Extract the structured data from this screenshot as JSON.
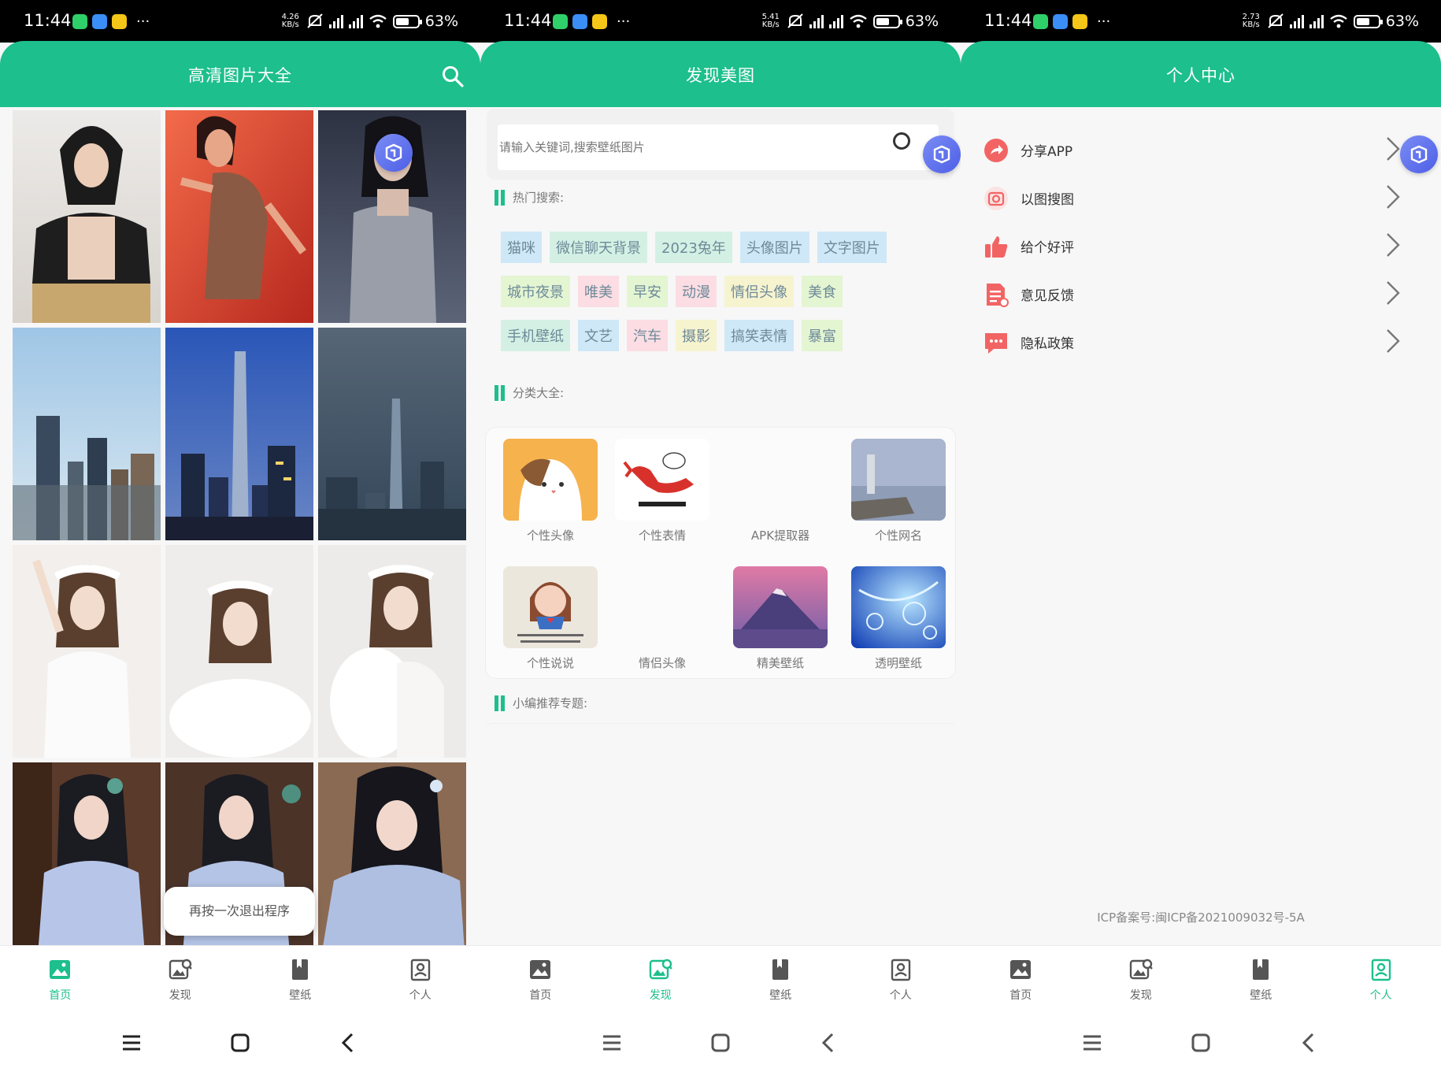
{
  "status_bars": [
    {
      "time": "11:44",
      "speed_value": "4.26",
      "speed_unit": "KB/s",
      "battery": "63%",
      "battery_level": 0.63
    },
    {
      "time": "11:44",
      "speed_value": "5.41",
      "speed_unit": "KB/s",
      "battery": "63%",
      "battery_level": 0.63
    },
    {
      "time": "11:44",
      "speed_value": "2.73",
      "speed_unit": "KB/s",
      "battery": "63%",
      "battery_level": 0.63
    }
  ],
  "status_dots": "···",
  "home": {
    "title": "高清图片大全",
    "toast": "再按一次退出程序",
    "images": [
      "portrait-black-jacket",
      "portrait-red-dress",
      "portrait-silver-dress",
      "city-skyline-day",
      "city-tower-dusk",
      "city-skyline-night",
      "girl-white-1",
      "girl-white-2",
      "girl-white-3",
      "hanfu-1",
      "hanfu-2",
      "hanfu-3"
    ]
  },
  "discover": {
    "title": "发现美图",
    "search_placeholder": "请输入关键词,搜索壁纸图片",
    "hot_label": "热门搜索:",
    "tags": [
      [
        {
          "text": "猫咪",
          "bg": "#cfe8f7"
        },
        {
          "text": "微信聊天背景",
          "bg": "#d4f0e4"
        },
        {
          "text": "2023兔年",
          "bg": "#d4f0e4"
        },
        {
          "text": "头像图片",
          "bg": "#cfe8f7"
        },
        {
          "text": "文字图片",
          "bg": "#cfe8f7"
        }
      ],
      [
        {
          "text": "城市夜景",
          "bg": "#e4f5d2"
        },
        {
          "text": "唯美",
          "bg": "#fbdde3"
        },
        {
          "text": "早安",
          "bg": "#e4f5d2"
        },
        {
          "text": "动漫",
          "bg": "#fbdde3"
        },
        {
          "text": "情侣头像",
          "bg": "#f6f3cf"
        },
        {
          "text": "美食",
          "bg": "#e4f5d2"
        }
      ],
      [
        {
          "text": "手机壁纸",
          "bg": "#d4f0e4"
        },
        {
          "text": "文艺",
          "bg": "#cfe8f7"
        },
        {
          "text": "汽车",
          "bg": "#fbdde3"
        },
        {
          "text": "摄影",
          "bg": "#f6f3cf"
        },
        {
          "text": "搞笑表情",
          "bg": "#cfe8f7"
        },
        {
          "text": "暴富",
          "bg": "#e4f5d2"
        }
      ]
    ],
    "category_label": "分类大全:",
    "categories": [
      "个性头像",
      "个性表情",
      "APK提取器",
      "个性网名",
      "个性说说",
      "情侣头像",
      "精美壁纸",
      "透明壁纸"
    ],
    "recommend_label": "小编推荐专题:"
  },
  "profile": {
    "title": "个人中心",
    "menu": [
      {
        "label": "分享APP",
        "icon": "share-icon",
        "color": "#f26464"
      },
      {
        "label": "以图搜图",
        "icon": "camera-icon",
        "color": "#f26464"
      },
      {
        "label": "给个好评",
        "icon": "thumbs-up-icon",
        "color": "#f26464"
      },
      {
        "label": "意见反馈",
        "icon": "feedback-icon",
        "color": "#f26464"
      },
      {
        "label": "隐私政策",
        "icon": "chat-icon",
        "color": "#f26464"
      }
    ],
    "icp": "ICP备案号:闽ICP备2021009032号-5A"
  },
  "nav": {
    "home": "首页",
    "discover": "发现",
    "wallpaper": "壁纸",
    "personal": "个人"
  },
  "colors": {
    "accent": "#1dbf8c",
    "nav_inactive": "#666666",
    "float_button": "#5b6cf0"
  }
}
